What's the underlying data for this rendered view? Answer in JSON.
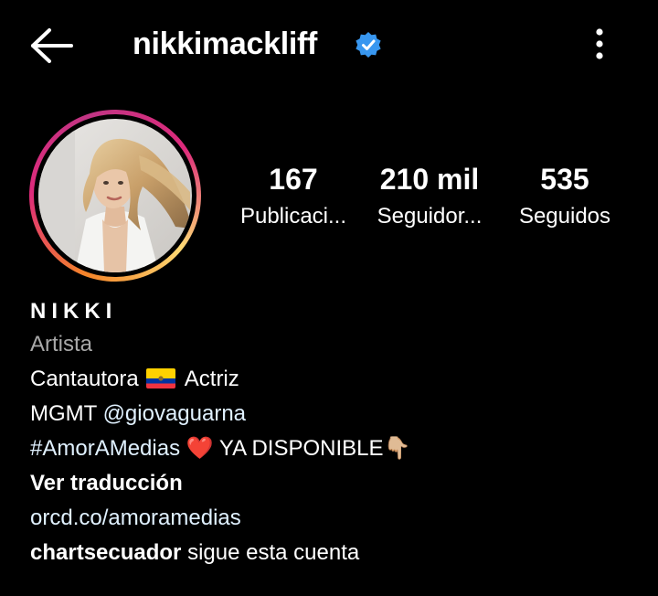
{
  "header": {
    "back_icon": "arrow-left-icon",
    "username": "nikkimackliff",
    "verified_icon": "verified-badge-icon",
    "verified_color": "#3897f0",
    "more_icon": "more-vertical-icon"
  },
  "profile": {
    "avatar_icon": "profile-photo",
    "stats": [
      {
        "value": "167",
        "label": "Publicaci..."
      },
      {
        "value": "210 mil",
        "label": "Seguidor..."
      },
      {
        "value": "535",
        "label": "Seguidos"
      }
    ]
  },
  "bio": {
    "name": "NIKKI",
    "category": "Artista",
    "line1_a": "Cantautora",
    "line1_b": "Actriz",
    "line2_a": "MGMT",
    "line2_handle": "@giovaguarna",
    "line3_hashtag": "#AmorAMedias",
    "line3_heart": "❤️",
    "line3_text": "YA DISPONIBLE",
    "line3_emoji": "👇🏼",
    "translate": "Ver traducción",
    "link": "orcd.co/amoramedias",
    "followed_by_user": "chartsecuador",
    "followed_by_text": " sigue esta cuenta",
    "flag_colors": [
      "#ffd100",
      "#0033a0",
      "#ef3340"
    ]
  }
}
